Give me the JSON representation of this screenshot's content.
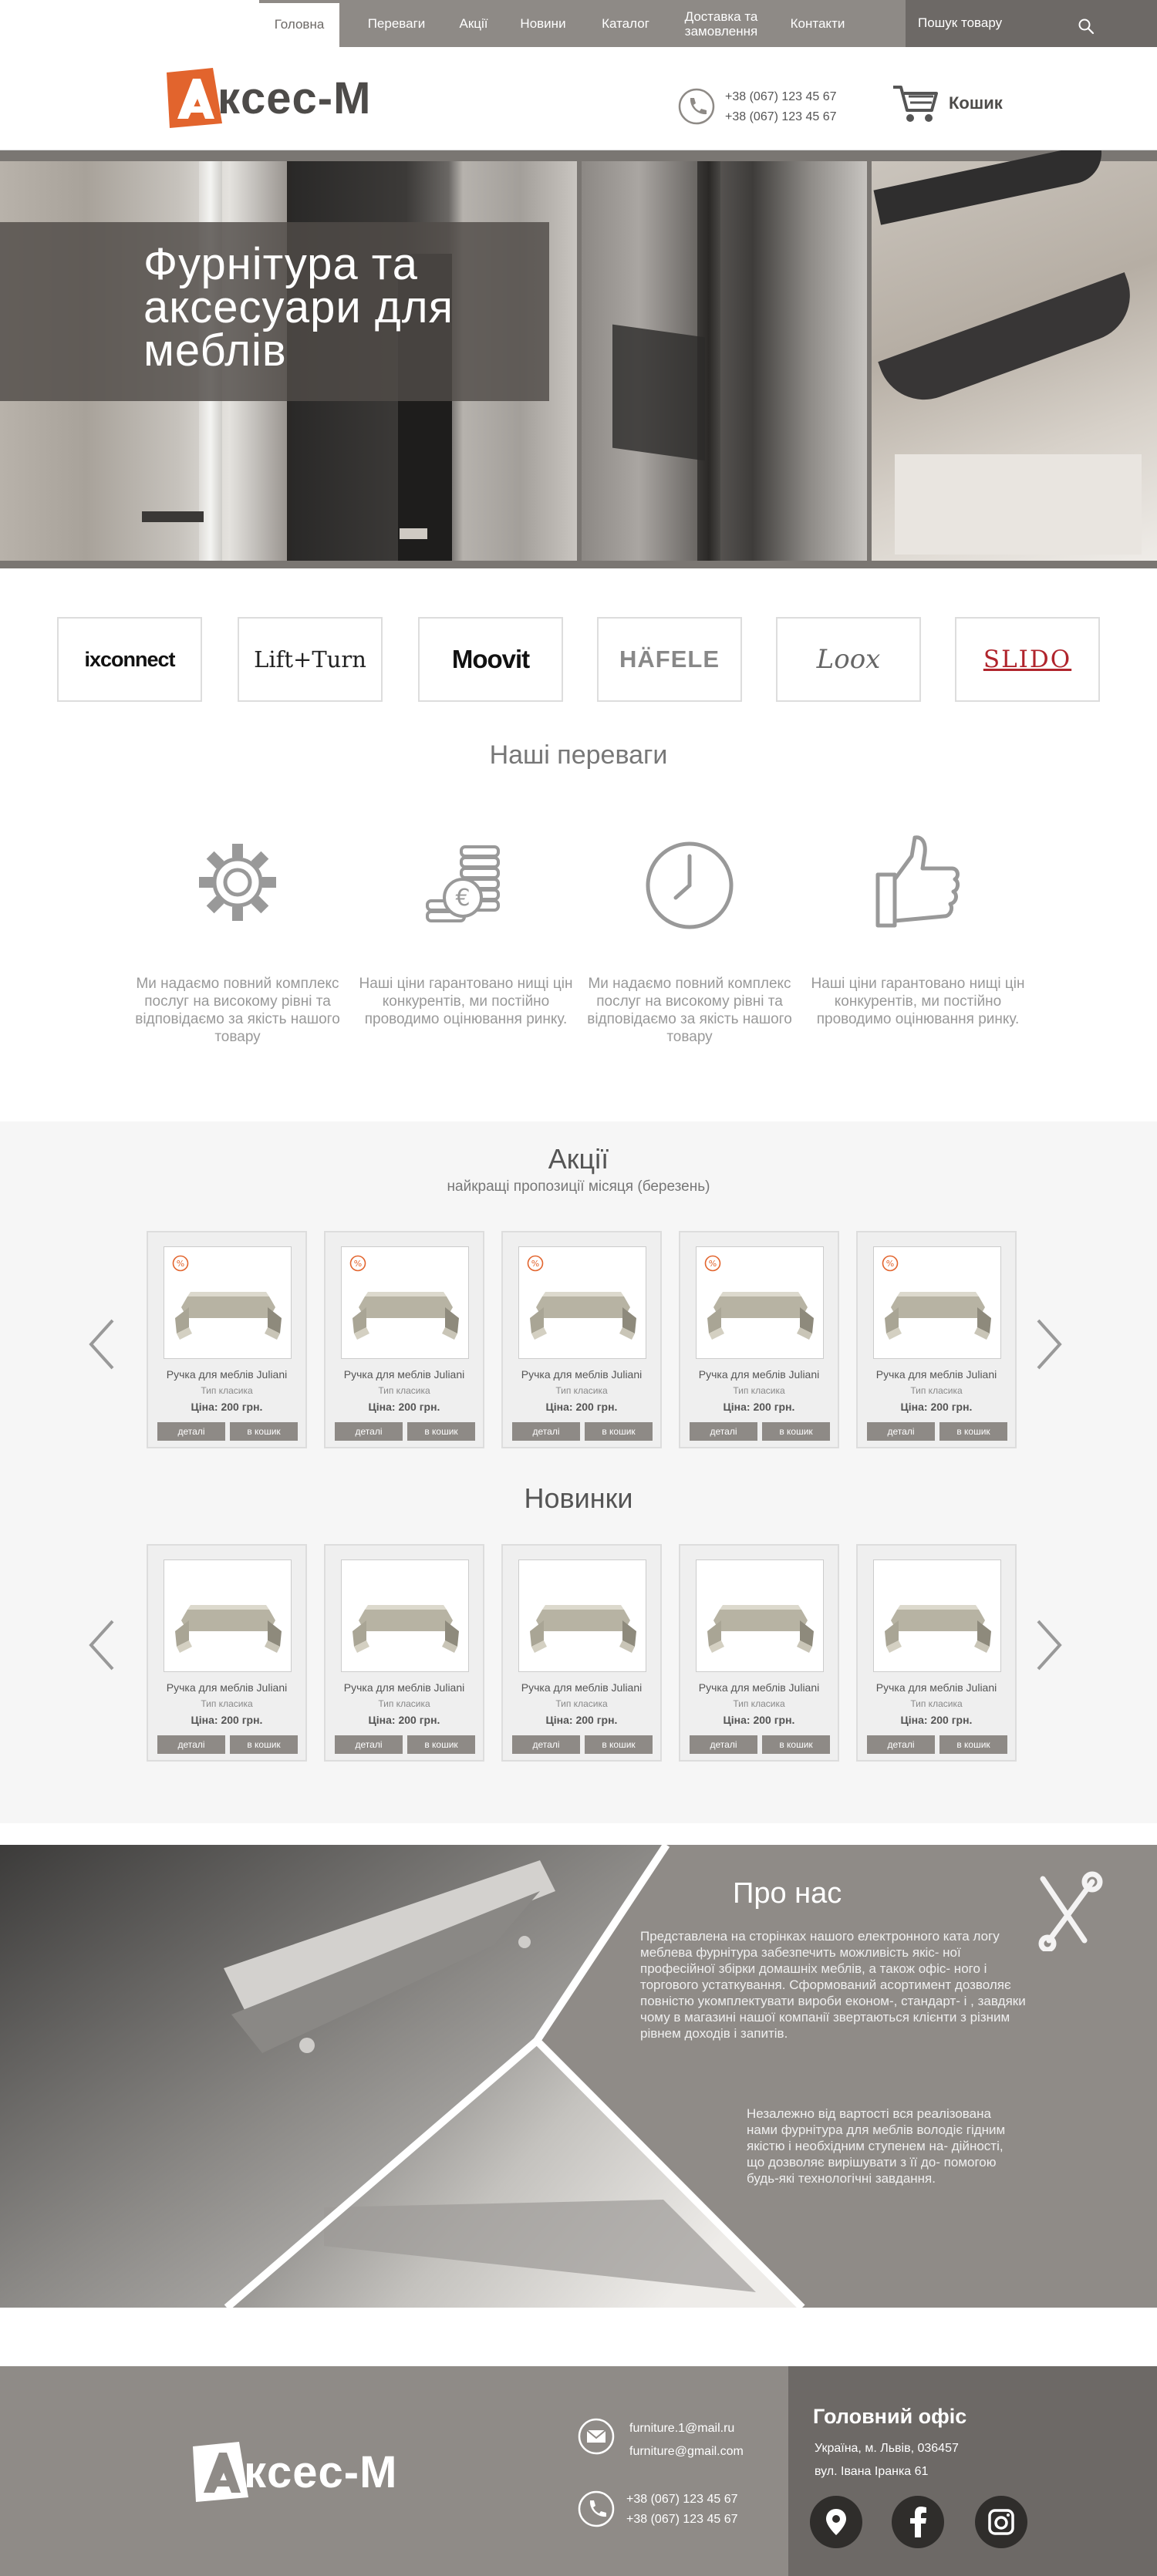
{
  "nav": {
    "items": [
      "Головна",
      "Переваги",
      "Акції",
      "Новини",
      "Каталог",
      "Доставка та\nзамовлення",
      "Контакти"
    ],
    "search_placeholder": "Пошук товару"
  },
  "header": {
    "logo_text": "кcеc-M",
    "phone_1": "+38 (067) 123 45 67",
    "phone_2": "+38 (067) 123 45 67",
    "cart_label": "Кошик"
  },
  "hero": {
    "title": "Фурнітура та аксесуари для меблів"
  },
  "brands": [
    "ixconnect",
    "Lift+Turn",
    "Moovit",
    "HÄFELE",
    "Loox",
    "SLIDO"
  ],
  "advantages": {
    "title": "Наші переваги",
    "items": [
      {
        "icon": "gear-icon",
        "text": "Ми надаємо повний комплекс послуг на високому рівні та відповідаємо за якість нашого товару"
      },
      {
        "icon": "coins-euro-icon",
        "text": "Наші ціни гарантовано нищі цін конкурентів, ми постійно проводимо оцінювання ринку."
      },
      {
        "icon": "clock-icon",
        "text": "Ми надаємо повний комплекс послуг на високому рівні та відповідаємо за якість нашого товару"
      },
      {
        "icon": "thumbs-up-icon",
        "text": "Наші ціни гарантовано нищі цін конкурентів, ми постійно проводимо оцінювання ринку."
      }
    ]
  },
  "sales": {
    "title": "Акції",
    "subtitle": "найкращі пропозиції місяця (березень)"
  },
  "news": {
    "title": "Новинки"
  },
  "product": {
    "name": "Ручка для меблів Juliani",
    "type": "Тип класика",
    "price": "Ціна: 200 грн.",
    "details_label": "деталі",
    "cart_label": "в кошик"
  },
  "about": {
    "title": "Про нас",
    "p1": "Представлена на сторінках нашого електронного ката логу меблева фурнітура забезпечить можливість якіс- ної професійної збірки домашніх меблів, а також офіс- ного і торгового устаткування. Сформований асортимент дозволяє повністю укомплектувати вироби економ-, стандарт- і , завдяки чому в магазині нашої компанії звертаються клієнти з різним рівнем доходів і запитів.",
    "p2": "Незалежно від вартості вся реалізована нами фурнітура для меблів володіє гідним якістю і необхідним ступенем на- дійності, що дозволяє вирішувати з її до- помогою будь-які технологічні завдання."
  },
  "footer": {
    "logo_text": "кcеc-M",
    "email_1": "furniture.1@mail.ru",
    "email_2": "furniture@gmail.com",
    "phone_1": "+38 (067) 123 45 67",
    "phone_2": "+38 (067) 123 45 67",
    "office_title": "Головний офіс",
    "office_line_1": "Україна, м. Львів, 036457",
    "office_line_2": "вул. Івана Іранка 61"
  },
  "colors": {
    "accent_orange": "#e2642d",
    "nav_grey": "#8e8a86",
    "dark_grey": "#6d6966"
  }
}
